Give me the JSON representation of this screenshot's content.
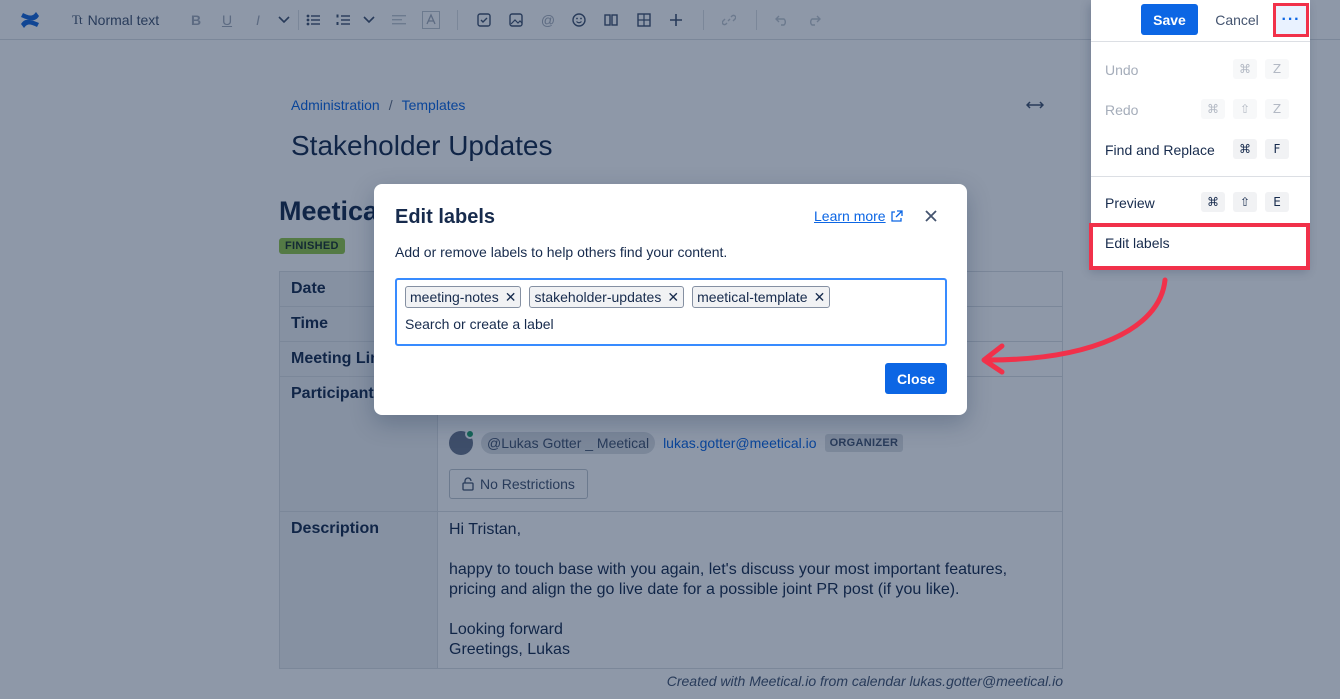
{
  "toolbar": {
    "text_style_icon": "Tt",
    "text_style_label": "Normal text",
    "icons": [
      "confluence-logo-icon",
      "bold-icon",
      "underline-icon",
      "italic-icon",
      "chevron-down-icon",
      "bullet-list-icon",
      "numbered-list-icon",
      "chevron-down-icon",
      "align-icon",
      "text-color-icon",
      "task-icon",
      "image-icon",
      "mention-icon",
      "emoji-icon",
      "layout-icon",
      "table-icon",
      "insert-icon",
      "link-icon",
      "undo-icon",
      "redo-icon"
    ]
  },
  "page": {
    "breadcrumbs": [
      "Administration",
      "Templates"
    ],
    "breadcrumb_sep": "/",
    "title": "Stakeholder Updates",
    "doc_title": "Meetical",
    "status": "FINISHED",
    "rows": {
      "date": "Date",
      "time": "Time",
      "meeting_link": "Meeting Link",
      "participants": "Participants",
      "description": "Description"
    },
    "participant": {
      "mention": "@Lukas Gotter _ Meetical",
      "email": "lukas.gotter@meetical.io",
      "role": "ORGANIZER"
    },
    "restrictions": "No Restrictions",
    "description_lines": {
      "greeting": "Hi Tristan,",
      "line1": "happy to touch base with you again, let's discuss your most important features,",
      "line2": "pricing and align the go live date for a possible joint PR post (if you like).",
      "line3": "Looking forward",
      "line4": "Greetings, Lukas"
    },
    "footer": "Created with Meetical.io from calendar lukas.gotter@meetical.io"
  },
  "dialog": {
    "title": "Edit labels",
    "learn_more": "Learn more",
    "description": "Add or remove labels to help others find your content.",
    "labels": [
      "meeting-notes",
      "stakeholder-updates",
      "meetical-template"
    ],
    "input_placeholder": "Search or create a label",
    "close_button": "Close"
  },
  "header_actions": {
    "save": "Save",
    "cancel": "Cancel",
    "more": "···"
  },
  "menu": {
    "undo": {
      "label": "Undo",
      "keys": [
        "⌘",
        "Z"
      ],
      "enabled": false
    },
    "redo": {
      "label": "Redo",
      "keys": [
        "⌘",
        "⇧",
        "Z"
      ],
      "enabled": false
    },
    "find_replace": {
      "label": "Find and Replace",
      "keys": [
        "⌘",
        "F"
      ],
      "enabled": true
    },
    "preview": {
      "label": "Preview",
      "keys": [
        "⌘",
        "⇧",
        "E"
      ],
      "enabled": true
    },
    "edit_labels": {
      "label": "Edit labels",
      "enabled": true
    }
  },
  "colors": {
    "primary": "#0c66e4",
    "highlight": "#f1314a",
    "status": "#94c748"
  }
}
